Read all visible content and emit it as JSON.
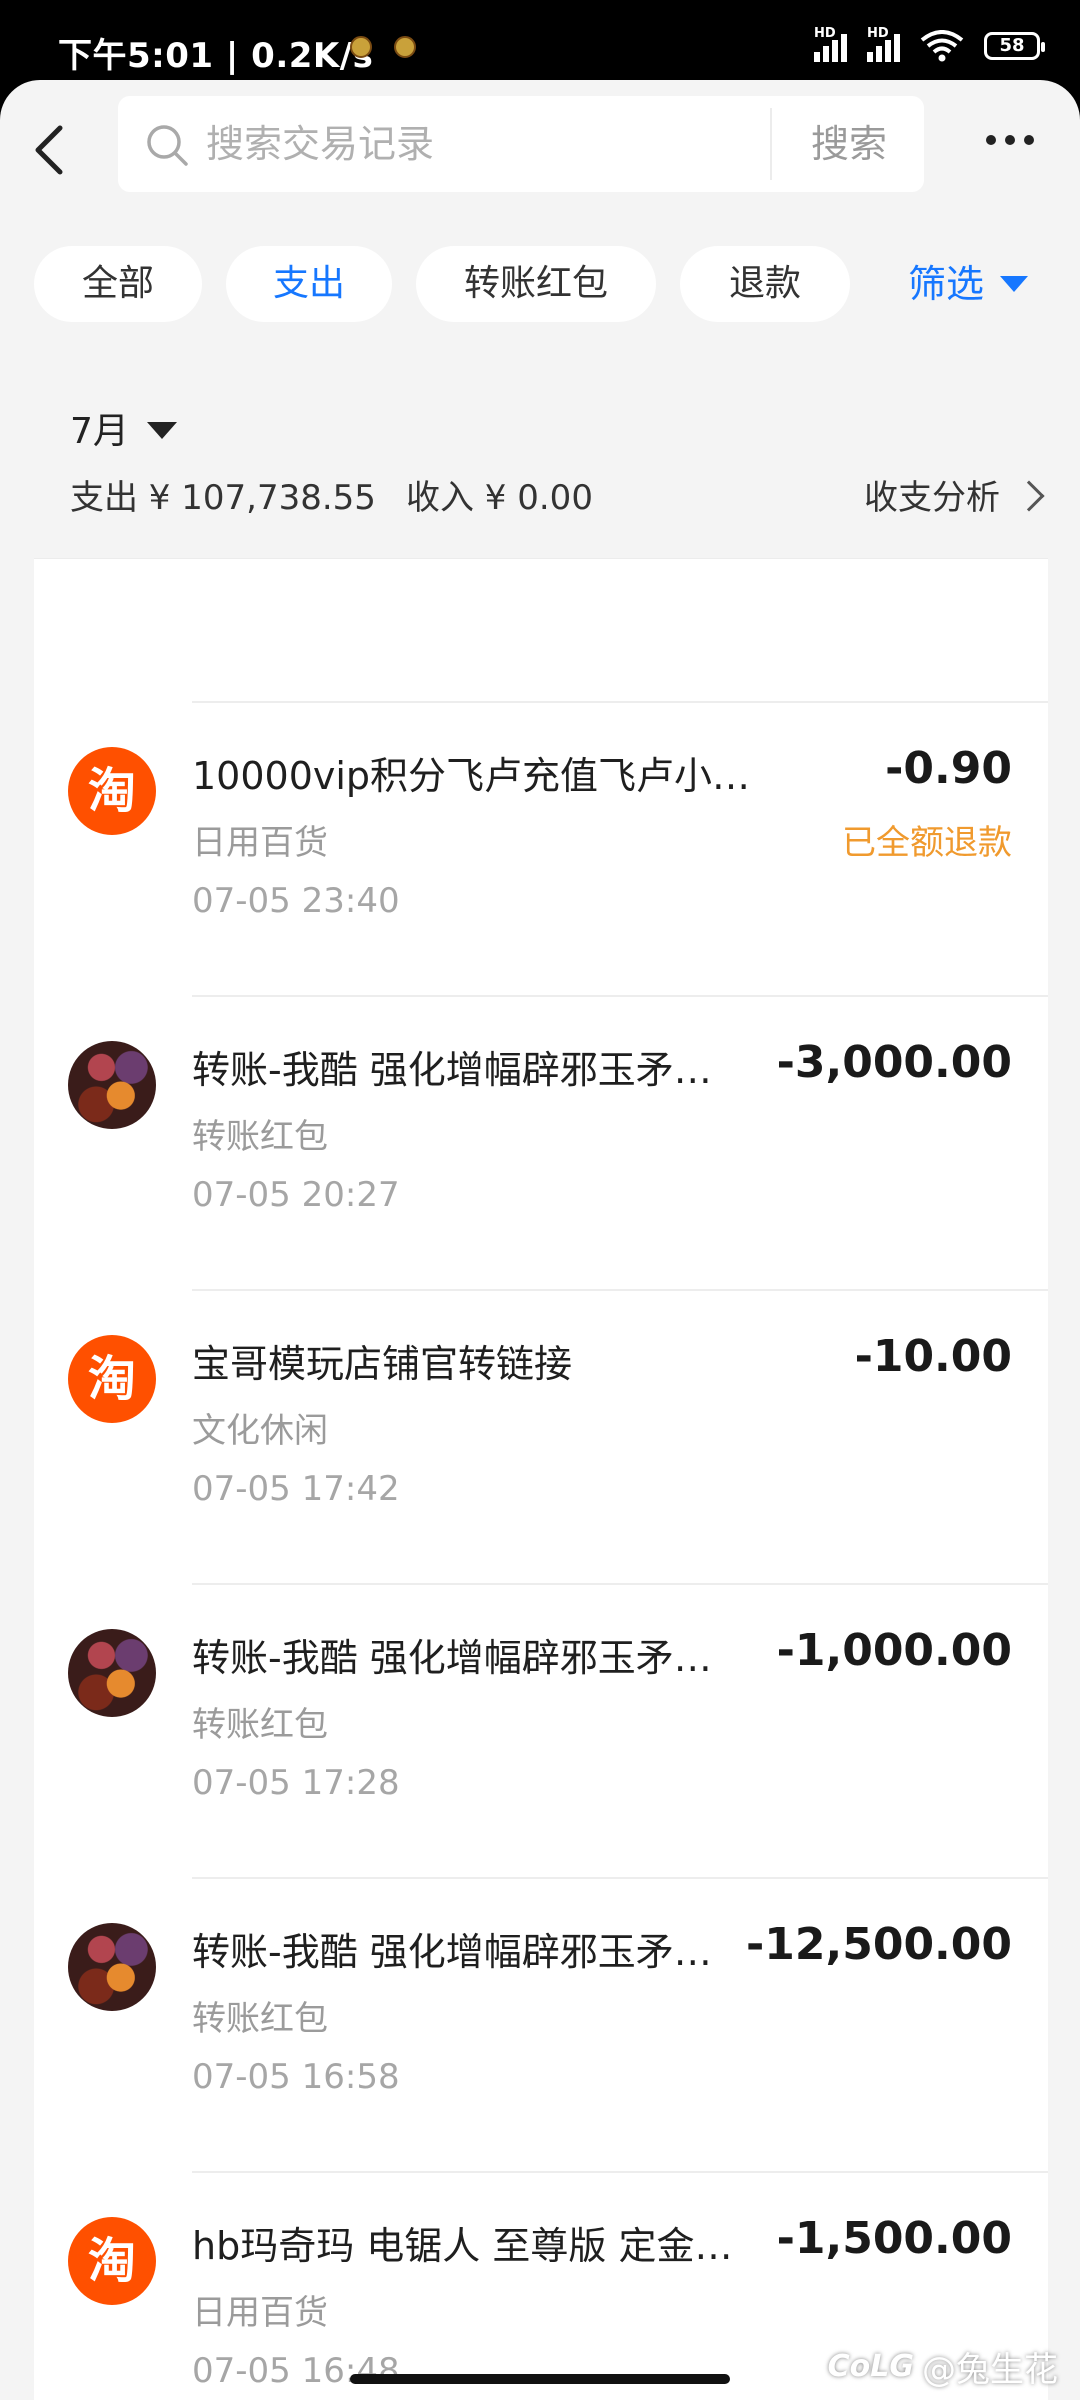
{
  "status_bar": {
    "time_speed": "下午5:01 | 0.2K/s",
    "signal_label": "HD",
    "battery": "58"
  },
  "search": {
    "placeholder": "搜索交易记录",
    "button": "搜索"
  },
  "filters": {
    "chips": [
      "全部",
      "支出",
      "转账红包",
      "退款"
    ],
    "active": "支出",
    "filter_label": "筛选"
  },
  "month": {
    "label": "7月",
    "expense": "支出 ¥ 107,738.55",
    "income": "收入 ¥ 0.00",
    "analysis": "收支分析"
  },
  "transactions": [
    {
      "icon": "taobao-icon",
      "icon_text": "淘",
      "title": "10000vip积分飞卢充值飞卢小…",
      "category": "日用百货",
      "time": "07-05 23:40",
      "amount": "-0.90",
      "status": "已全额退款"
    },
    {
      "icon": "user-avatar-icon",
      "icon_text": "",
      "title": "转账-我酷 强化增幅辟邪玉矛…",
      "category": "转账红包",
      "time": "07-05 20:27",
      "amount": "-3,000.00",
      "status": ""
    },
    {
      "icon": "taobao-icon",
      "icon_text": "淘",
      "title": "宝哥模玩店铺官转链接",
      "category": "文化休闲",
      "time": "07-05 17:42",
      "amount": "-10.00",
      "status": ""
    },
    {
      "icon": "user-avatar-icon",
      "icon_text": "",
      "title": "转账-我酷 强化增幅辟邪玉矛…",
      "category": "转账红包",
      "time": "07-05 17:28",
      "amount": "-1,000.00",
      "status": ""
    },
    {
      "icon": "user-avatar-icon",
      "icon_text": "",
      "title": "转账-我酷 强化增幅辟邪玉矛…",
      "category": "转账红包",
      "time": "07-05 16:58",
      "amount": "-12,500.00",
      "status": ""
    },
    {
      "icon": "taobao-icon",
      "icon_text": "淘",
      "title": "hb玛奇玛 电锯人 至尊版 定金…",
      "category": "日用百货",
      "time": "07-05 16:48",
      "amount": "-1,500.00",
      "status": ""
    }
  ],
  "watermark": {
    "logo": "CoLG",
    "text": "@兔生花"
  }
}
